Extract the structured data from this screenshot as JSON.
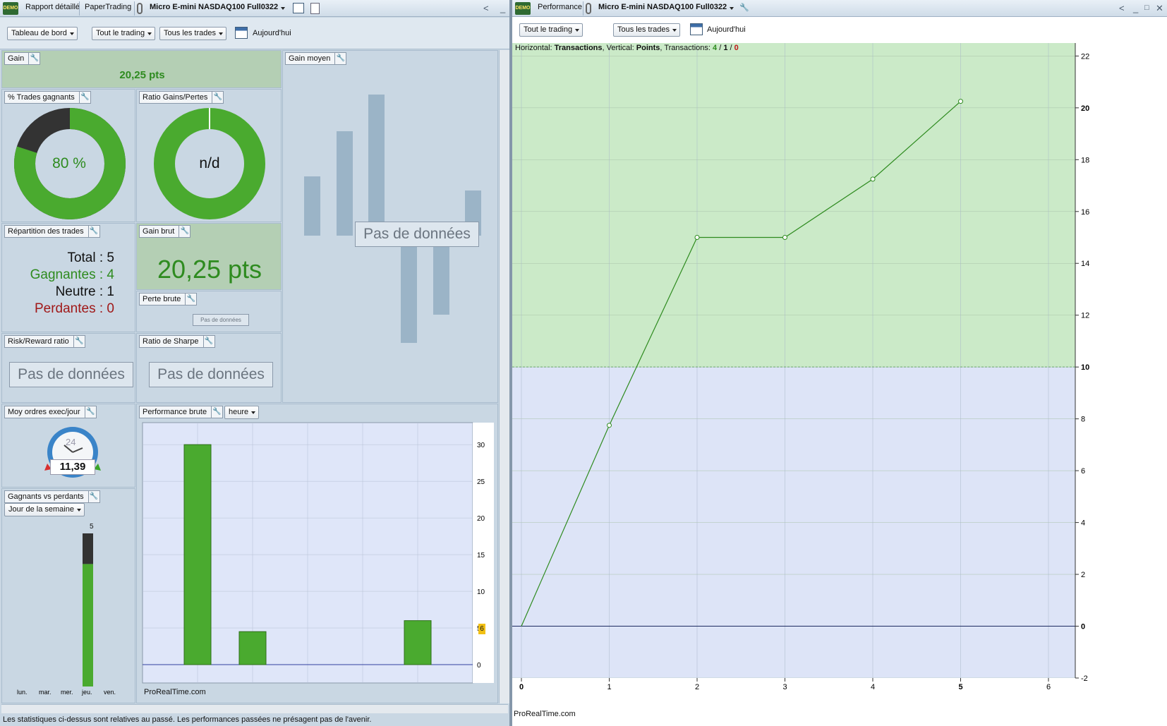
{
  "left": {
    "tabs": [
      "Rapport détaillé",
      "PaperTrading",
      "Micro E-mini NASDAQ100 Full0322"
    ],
    "toolbar": {
      "dashboard": "Tableau de bord",
      "scope": "Tout le trading",
      "trades": "Tous les trades",
      "period": "Aujourd'hui"
    },
    "gain": {
      "title": "Gain",
      "value": "20,25 pts"
    },
    "pct_win": {
      "title": "% Trades gagnants",
      "value": "80 %",
      "fraction": 0.8
    },
    "ratio": {
      "title": "Ratio Gains/Pertes",
      "value": "n/d"
    },
    "avg_gain": {
      "title": "Gain moyen",
      "nodata": "Pas de données"
    },
    "repartition": {
      "title": "Répartition des trades",
      "total": "Total : 5",
      "winners": "Gagnantes : 4",
      "neutral": "Neutre : 1",
      "losers": "Perdantes : 0"
    },
    "gross_gain": {
      "title": "Gain brut",
      "value": "20,25 pts"
    },
    "gross_loss": {
      "title": "Perte brute",
      "nodata": "Pas de données"
    },
    "risk_reward": {
      "title": "Risk/Reward ratio",
      "nodata": "Pas de données"
    },
    "sharpe": {
      "title": "Ratio de Sharpe",
      "nodata": "Pas de données"
    },
    "orders": {
      "title": "Moy ordres exec/jour",
      "clock": "24",
      "value": "11,39"
    },
    "winloss": {
      "title": "Gagnants vs perdants",
      "selector": "Jour de la semaine",
      "bar_total": "5",
      "days": [
        "lun.",
        "mar.",
        "mer.",
        "jeu.",
        "ven."
      ]
    },
    "perf_brute": {
      "title": "Performance brute",
      "selector": "heure",
      "brand": "ProRealTime.com",
      "marker": "6"
    },
    "footer": "Les statistiques ci-dessus sont relatives au passé. Les performances passées ne présagent pas de l'avenir."
  },
  "right": {
    "tabs": [
      "Performance",
      "Micro E-mini NASDAQ100 Full0322"
    ],
    "toolbar": {
      "scope": "Tout le trading",
      "trades": "Tous les trades",
      "period": "Aujourd'hui"
    },
    "info": {
      "h_label": "Horizontal: ",
      "h_value": "Transactions",
      "v_label": ", Vertical: ",
      "v_value": "Points",
      "t_label": ", Transactions: ",
      "t_win": "4",
      "t_neutral": "1",
      "t_loss": "0"
    },
    "brand": "ProRealTime.com"
  },
  "chart_data": [
    {
      "type": "line",
      "title": "",
      "x": [
        0,
        1,
        2,
        3,
        4,
        5
      ],
      "y": [
        0,
        7.75,
        15.0,
        15.0,
        17.25,
        20.25
      ],
      "xlim": [
        0,
        6.3
      ],
      "ylim": [
        -2,
        22.5
      ],
      "yticks": [
        -2,
        0,
        2,
        4,
        6,
        8,
        10,
        12,
        14,
        16,
        18,
        20,
        22
      ],
      "xticks": [
        0,
        1,
        2,
        3,
        4,
        5,
        6
      ],
      "threshold": 10,
      "grid": true
    },
    {
      "type": "bar",
      "title": "",
      "values": [
        30,
        4.5,
        0,
        0,
        6
      ],
      "ylim": [
        -2.5,
        33
      ],
      "yticks": [
        0,
        5,
        10,
        15,
        20,
        25,
        30
      ],
      "grid": true
    },
    {
      "type": "bar",
      "title": "",
      "values": [
        1.05,
        1.85,
        2.5,
        -1.9,
        -1.4,
        0.8
      ],
      "ylim": [
        -2.5,
        3
      ]
    },
    {
      "type": "bar",
      "title": "",
      "categories": [
        "lun.",
        "mar.",
        "mer.",
        "jeu.",
        "ven."
      ],
      "series": [
        {
          "values": [
            0,
            0,
            0,
            4,
            0
          ]
        },
        {
          "values": [
            0,
            0,
            0,
            1,
            0
          ]
        }
      ],
      "ylim": [
        0,
        5
      ]
    }
  ]
}
